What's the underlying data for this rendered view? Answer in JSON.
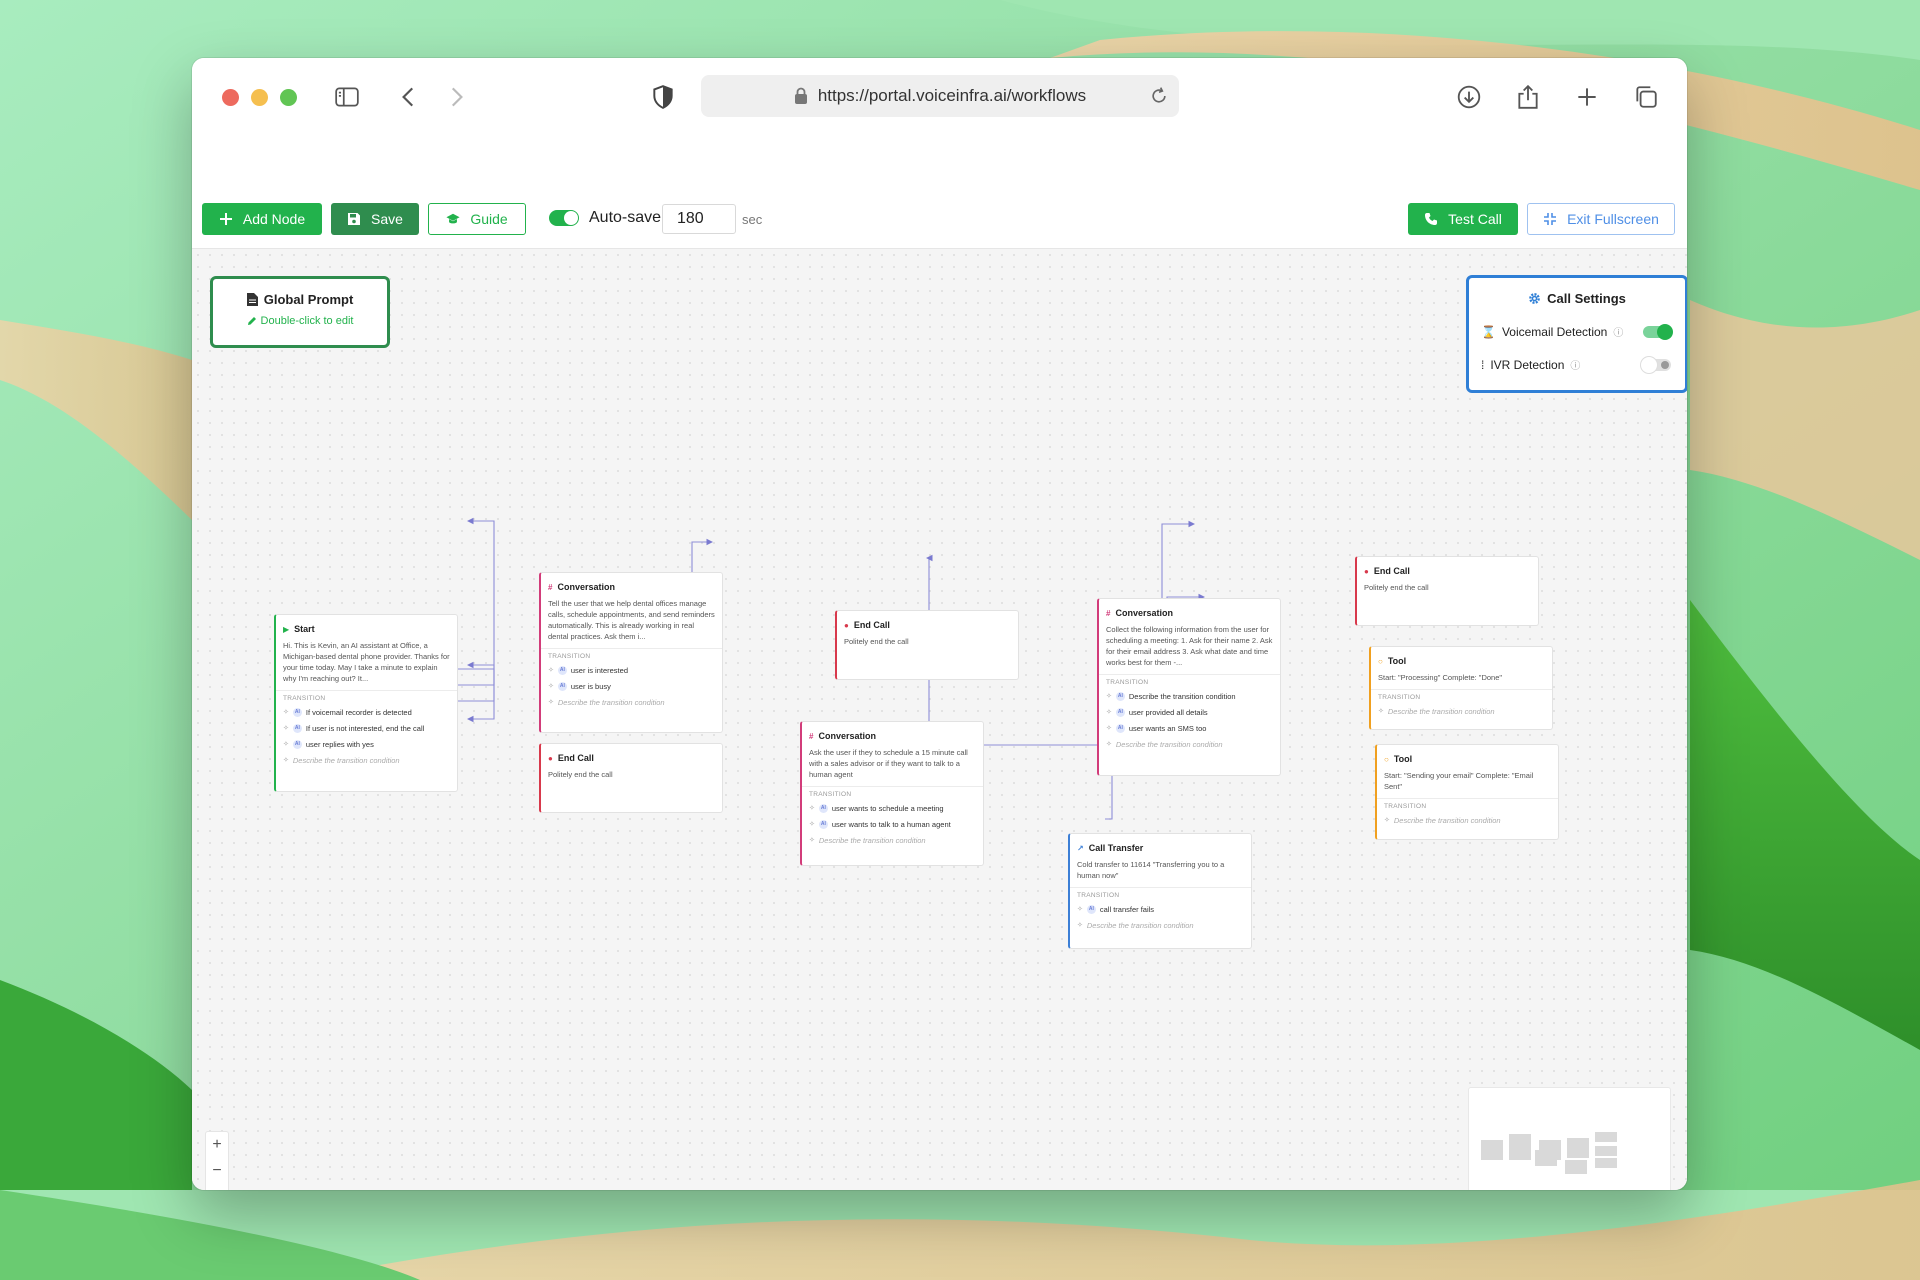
{
  "browser": {
    "url": "https://portal.voiceinfra.ai/workflows",
    "icons": [
      "sidebar-icon",
      "back-icon",
      "forward-icon",
      "shield-icon",
      "lock-icon",
      "reload-icon",
      "download-icon",
      "share-icon",
      "new-tab-icon",
      "tabs-overview-icon"
    ]
  },
  "toolbar": {
    "add_node": "Add Node",
    "save": "Save",
    "guide": "Guide",
    "autosave_label": "Auto-save",
    "autosave_enabled": true,
    "autosave_seconds": "180",
    "autosave_unit": "sec",
    "test_call": "Test Call",
    "exit_fullscreen": "Exit Fullscreen"
  },
  "global_prompt": {
    "title": "Global Prompt",
    "hint": "Double-click to edit"
  },
  "call_settings": {
    "title": "Call Settings",
    "voicemail_label": "Voicemail Detection",
    "voicemail_enabled": true,
    "ivr_label": "IVR Detection",
    "ivr_enabled": false
  },
  "labels": {
    "transition": "TRANSITION",
    "placeholder": "Describe the transition condition",
    "ai_badge": "AI"
  },
  "nodes": {
    "start": {
      "title": "Start",
      "body": "Hi. This is Kevin, an AI assistant at Office, a Michigan-based dental phone provider. Thanks for your time today. May I take a minute to explain why I'm reaching out? It...",
      "conditions": [
        "If voicemail recorder is detected",
        "If user is not interested, end the call",
        "user replies with yes"
      ]
    },
    "conv1": {
      "title": "Conversation",
      "body": "Tell the user that we help dental offices manage calls, schedule appointments, and send reminders automatically. This is already working in real dental practices. Ask them i...",
      "conditions": [
        "user is interested",
        "user is busy"
      ]
    },
    "end1": {
      "title": "End Call",
      "body": "Politely end the call"
    },
    "end2": {
      "title": "End Call",
      "body": "Politely end the call"
    },
    "conv2": {
      "title": "Conversation",
      "body": "Ask the user if they to schedule a 15 minute call with a sales advisor or if they want to talk to a human agent",
      "conditions": [
        "user wants to schedule a meeting",
        "user wants to talk to a human agent"
      ]
    },
    "conv3": {
      "title": "Conversation",
      "body": "Collect the following information from the user for scheduling a meeting: 1. Ask for their name 2. Ask for their email address 3. Ask what date and time works best for them -...",
      "conditions": [
        "Describe the transition condition",
        "user provided all details",
        "user wants an SMS too"
      ]
    },
    "transfer": {
      "title": "Call Transfer",
      "body": "Cold transfer to 11614 \"Transferring you to a human now\"",
      "conditions": [
        "call transfer fails"
      ]
    },
    "end3": {
      "title": "End Call",
      "body": "Politely end the call"
    },
    "tool1": {
      "title": "Tool",
      "body": "Start: \"Processing\" Complete: \"Done\""
    },
    "tool2": {
      "title": "Tool",
      "body": "Start: \"Sending your email\" Complete: \"Email Sent\""
    }
  },
  "canvas_controls": {
    "zoom_in": "+",
    "zoom_out": "−"
  }
}
